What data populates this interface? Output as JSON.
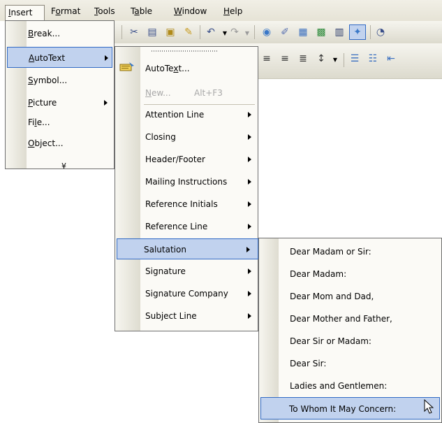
{
  "menubar": {
    "items": [
      "Insert",
      "Format",
      "Tools",
      "Table",
      "Window",
      "Help"
    ]
  },
  "toolbar": {
    "icons": [
      "cut-icon",
      "copy-icon",
      "paste-icon",
      "format-painter-icon",
      "undo-icon",
      "redo-icon",
      "hyperlink-icon",
      "drawing-icon",
      "table-icon",
      "excel-icon",
      "columns-icon",
      "autotext-toolbar-icon",
      "zoom-icon"
    ],
    "row2_icons": [
      "align-center-icon",
      "align-right-icon",
      "justify-icon",
      "line-spacing-icon",
      "numbering-icon",
      "bullets-icon",
      "indent-icon"
    ]
  },
  "insert_menu": {
    "items": [
      {
        "label": "Break...",
        "has_submenu": false
      },
      {
        "label": "AutoText",
        "has_submenu": true,
        "selected": true
      },
      {
        "label": "Symbol...",
        "has_submenu": false
      },
      {
        "label": "Picture",
        "has_submenu": true
      },
      {
        "label": "File...",
        "has_submenu": false
      },
      {
        "label": "Object...",
        "has_submenu": false
      }
    ],
    "expand_glyph": "¥"
  },
  "autotext_menu": {
    "items": [
      {
        "label": "AutoText...",
        "has_submenu": false
      },
      {
        "label": "New...",
        "shortcut": "Alt+F3",
        "disabled": true
      },
      {
        "label": "Attention Line",
        "has_submenu": true
      },
      {
        "label": "Closing",
        "has_submenu": true
      },
      {
        "label": "Header/Footer",
        "has_submenu": true
      },
      {
        "label": "Mailing Instructions",
        "has_submenu": true
      },
      {
        "label": "Reference Initials",
        "has_submenu": true
      },
      {
        "label": "Reference Line",
        "has_submenu": true
      },
      {
        "label": "Salutation",
        "has_submenu": true,
        "selected": true
      },
      {
        "label": "Signature",
        "has_submenu": true
      },
      {
        "label": "Signature Company",
        "has_submenu": true
      },
      {
        "label": "Subject Line",
        "has_submenu": true
      }
    ]
  },
  "salutation_menu": {
    "items": [
      {
        "label": "Dear Madam or Sir:"
      },
      {
        "label": "Dear Madam:"
      },
      {
        "label": "Dear Mom and Dad,"
      },
      {
        "label": "Dear Mother and Father,"
      },
      {
        "label": "Dear Sir or Madam:"
      },
      {
        "label": "Dear Sir:"
      },
      {
        "label": "Ladies and Gentlemen:"
      },
      {
        "label": "To Whom It May Concern:",
        "selected": true
      }
    ]
  },
  "colors": {
    "highlight": "#c1d2ee",
    "highlight_border": "#316ac5",
    "menu_bg": "#fbfaf6",
    "menubar_bg": "#ece9d8"
  }
}
